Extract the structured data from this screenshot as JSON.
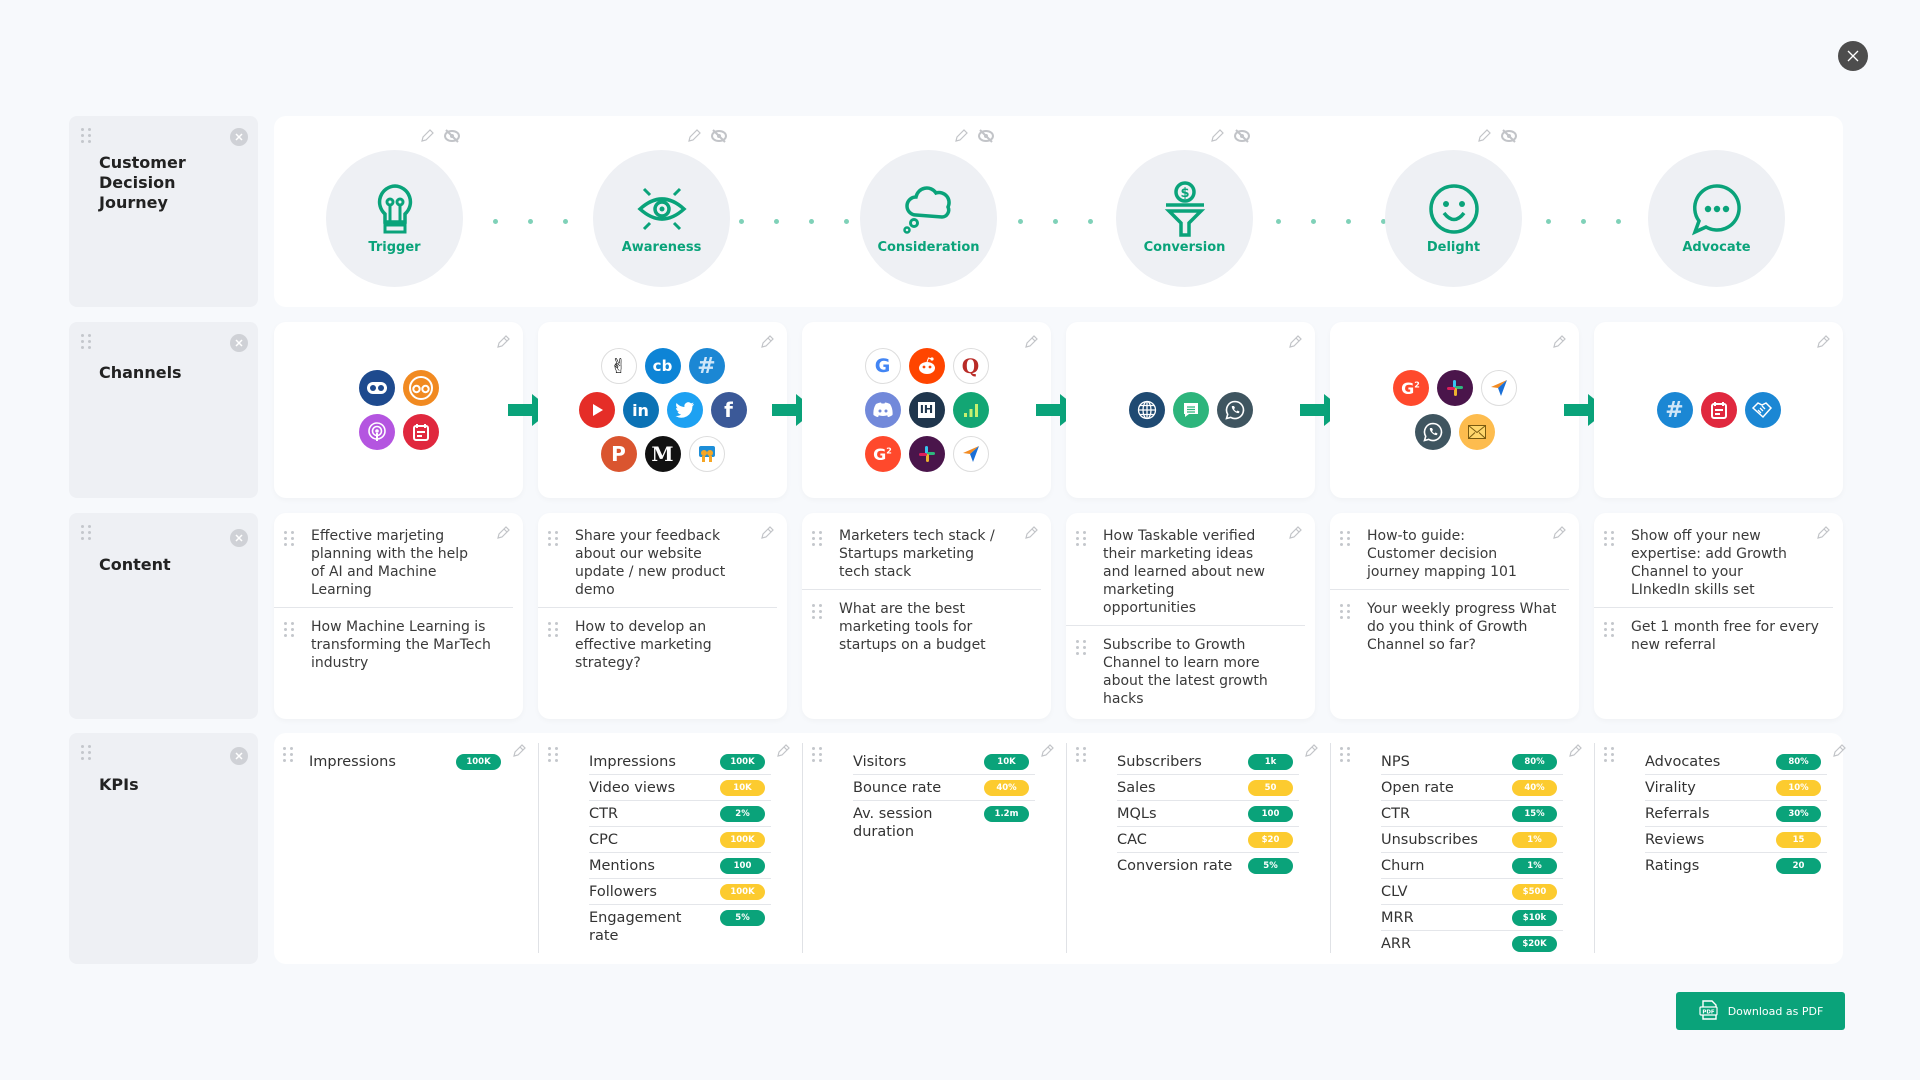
{
  "colors": {
    "accent": "#0aa37a",
    "badge_green": "#0aa37a",
    "badge_yellow": "#fccb2f",
    "label_bg": "#eef0f4"
  },
  "close_icon": "close-icon",
  "rows": {
    "journey": {
      "label": "Customer Decision Journey"
    },
    "channels": {
      "label": "Channels"
    },
    "content": {
      "label": "Content"
    },
    "kpis": {
      "label": "KPIs"
    }
  },
  "stages": [
    {
      "label": "Trigger",
      "icon": "lightbulb-icon"
    },
    {
      "label": "Awareness",
      "icon": "eye-icon"
    },
    {
      "label": "Consideration",
      "icon": "thought-cloud-icon"
    },
    {
      "label": "Conversion",
      "icon": "funnel-dollar-icon"
    },
    {
      "label": "Delight",
      "icon": "smiley-icon"
    },
    {
      "label": "Advocate",
      "icon": "chat-bubble-icon"
    }
  ],
  "channels": [
    [
      [
        "quora-bot-icon",
        "outbrain-icon"
      ],
      [
        "podcasts-icon",
        "calendar-form-icon"
      ]
    ],
    [
      [
        "angellist-icon",
        "crunchbase-icon",
        "hashtag-icon"
      ],
      [
        "youtube-icon",
        "linkedin-icon",
        "twitter-icon",
        "facebook-icon"
      ],
      [
        "producthunt-icon",
        "medium-icon",
        "slideshare-icon"
      ]
    ],
    [
      [
        "google-icon",
        "reddit-icon",
        "quora-icon"
      ],
      [
        "discord-icon",
        "indiehackers-icon",
        "analytics-icon"
      ],
      [
        "g2-icon",
        "slack-icon",
        "send-arrow-icon"
      ]
    ],
    [
      [
        "globe-icon",
        "sms-icon",
        "whatsapp-icon"
      ]
    ],
    [
      [
        "g2-icon",
        "slack-icon",
        "send-arrow-icon"
      ],
      [
        "whatsapp-icon",
        "email-icon"
      ]
    ],
    [
      [
        "hashtag-icon",
        "calendar-form-icon",
        "handshake-icon"
      ]
    ]
  ],
  "content": [
    [
      "Effective marjeting planning with the help of AI and Machine Learning",
      "How Machine Learning is transforming the MarTech industry"
    ],
    [
      "Share your feedback about our website update / new product demo",
      "How to develop an effective marketing strategy?"
    ],
    [
      "Marketers tech stack / Startups marketing tech stack",
      "What are the best marketing tools for startups on a budget"
    ],
    [
      "How Taskable verified their marketing ideas and learned about new marketing opportunities",
      "Subscribe to Growth Channel to learn more about the latest growth hacks"
    ],
    [
      "How-to guide: Customer decision journey mapping 101",
      "Your weekly progress What do you think of Growth Channel so far?"
    ],
    [
      "Show off your new expertise: add Growth Channel to your LInkedIn skills set",
      "Get 1 month free for every new referral"
    ]
  ],
  "kpis": [
    [
      {
        "name": "Impressions",
        "value": "100K",
        "color": "green"
      }
    ],
    [
      {
        "name": "Impressions",
        "value": "100K",
        "color": "green"
      },
      {
        "name": "Video views",
        "value": "10K",
        "color": "yellow"
      },
      {
        "name": "CTR",
        "value": "2%",
        "color": "green"
      },
      {
        "name": "CPC",
        "value": "100K",
        "color": "yellow"
      },
      {
        "name": "Mentions",
        "value": "100",
        "color": "green"
      },
      {
        "name": "Followers",
        "value": "100K",
        "color": "yellow"
      },
      {
        "name": "Engagement rate",
        "value": "5%",
        "color": "green"
      }
    ],
    [
      {
        "name": "Visitors",
        "value": "10K",
        "color": "green"
      },
      {
        "name": "Bounce rate",
        "value": "40%",
        "color": "yellow"
      },
      {
        "name": "Av. session duration",
        "value": "1.2m",
        "color": "green"
      }
    ],
    [
      {
        "name": "Subscribers",
        "value": "1k",
        "color": "green"
      },
      {
        "name": "Sales",
        "value": "50",
        "color": "yellow"
      },
      {
        "name": "MQLs",
        "value": "100",
        "color": "green"
      },
      {
        "name": "CAC",
        "value": "$20",
        "color": "yellow"
      },
      {
        "name": "Conversion rate",
        "value": "5%",
        "color": "green"
      }
    ],
    [
      {
        "name": "NPS",
        "value": "80%",
        "color": "green"
      },
      {
        "name": "Open rate",
        "value": "40%",
        "color": "yellow"
      },
      {
        "name": "CTR",
        "value": "15%",
        "color": "green"
      },
      {
        "name": "Unsubscribes",
        "value": "1%",
        "color": "yellow"
      },
      {
        "name": "Churn",
        "value": "1%",
        "color": "green"
      },
      {
        "name": "CLV",
        "value": "$500",
        "color": "yellow"
      },
      {
        "name": "MRR",
        "value": "$10k",
        "color": "green"
      },
      {
        "name": "ARR",
        "value": "$20K",
        "color": "green"
      }
    ],
    [
      {
        "name": "Advocates",
        "value": "80%",
        "color": "green"
      },
      {
        "name": "Virality",
        "value": "10%",
        "color": "yellow"
      },
      {
        "name": "Referrals",
        "value": "30%",
        "color": "green"
      },
      {
        "name": "Reviews",
        "value": "15",
        "color": "yellow"
      },
      {
        "name": "Ratings",
        "value": "20",
        "color": "green"
      }
    ]
  ],
  "download": {
    "label": "Download as PDF",
    "icon": "pdf-icon"
  }
}
